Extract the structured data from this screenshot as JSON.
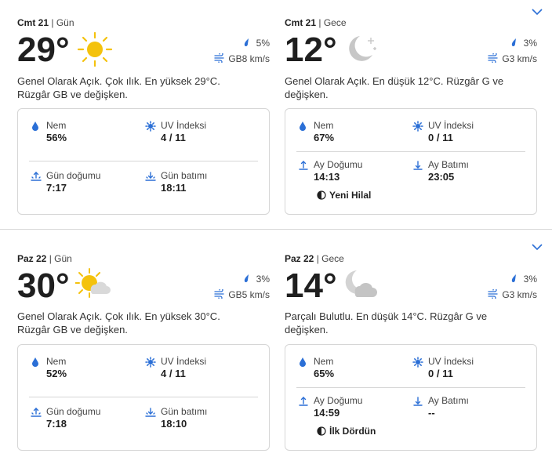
{
  "colors": {
    "accent": "#2b6fd6",
    "sun": "#f4c20d",
    "moon": "#c7c7c7",
    "cloud": "#bdbdbd"
  },
  "days": [
    {
      "day": {
        "date": "Cmt 21",
        "period": "Gün",
        "temp": "29°",
        "icon": "sunny-icon",
        "precip": "5%",
        "wind": "GB8 km/s",
        "desc": "Genel Olarak Açık. Çok ılık. En yüksek 29°C. Rüzgâr GB ve değişken.",
        "stats": [
          {
            "label": "Nem",
            "value": "56%",
            "icon": "humidity-icon"
          },
          {
            "label": "UV İndeksi",
            "value": "4 / 11",
            "icon": "uv-icon"
          },
          {
            "label": "Gün doğumu",
            "value": "7:17",
            "icon": "sunrise-icon"
          },
          {
            "label": "Gün batımı",
            "value": "18:11",
            "icon": "sunset-icon"
          }
        ]
      },
      "night": {
        "date": "Cmt 21",
        "period": "Gece",
        "temp": "12°",
        "icon": "clear-night-icon",
        "precip": "3%",
        "wind": "G3 km/s",
        "desc": "Genel Olarak Açık. En düşük 12°C. Rüzgâr G ve değişken.",
        "stats": [
          {
            "label": "Nem",
            "value": "67%",
            "icon": "humidity-icon"
          },
          {
            "label": "UV İndeksi",
            "value": "0 / 11",
            "icon": "uv-icon"
          },
          {
            "label": "Ay Doğumu",
            "value": "14:13",
            "icon": "moonrise-icon"
          },
          {
            "label": "Ay Batımı",
            "value": "23:05",
            "icon": "moonset-icon"
          }
        ],
        "moon_phase": "Yeni Hilal"
      }
    },
    {
      "day": {
        "date": "Paz 22",
        "period": "Gün",
        "temp": "30°",
        "icon": "mostly-sunny-icon",
        "precip": "3%",
        "wind": "GB5 km/s",
        "desc": "Genel Olarak Açık. Çok ılık. En yüksek 30°C. Rüzgâr GB ve değişken.",
        "stats": [
          {
            "label": "Nem",
            "value": "52%",
            "icon": "humidity-icon"
          },
          {
            "label": "UV İndeksi",
            "value": "4 / 11",
            "icon": "uv-icon"
          },
          {
            "label": "Gün doğumu",
            "value": "7:18",
            "icon": "sunrise-icon"
          },
          {
            "label": "Gün batımı",
            "value": "18:10",
            "icon": "sunset-icon"
          }
        ]
      },
      "night": {
        "date": "Paz 22",
        "period": "Gece",
        "temp": "14°",
        "icon": "partly-cloudy-night-icon",
        "precip": "3%",
        "wind": "G3 km/s",
        "desc": "Parçalı Bulutlu. En düşük 14°C. Rüzgâr G ve değişken.",
        "stats": [
          {
            "label": "Nem",
            "value": "65%",
            "icon": "humidity-icon"
          },
          {
            "label": "UV İndeksi",
            "value": "0 / 11",
            "icon": "uv-icon"
          },
          {
            "label": "Ay Doğumu",
            "value": "14:59",
            "icon": "moonrise-icon"
          },
          {
            "label": "Ay Batımı",
            "value": "--",
            "icon": "moonset-icon"
          }
        ],
        "moon_phase": "İlk Dördün"
      }
    }
  ]
}
